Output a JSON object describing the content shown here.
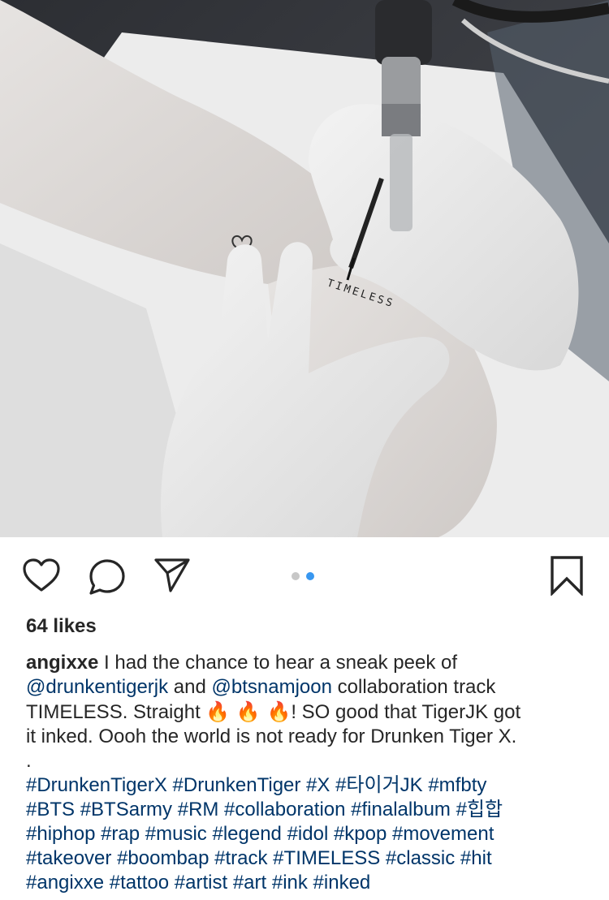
{
  "post": {
    "image": {
      "tattoo_text": "TIMELESS"
    },
    "actions": {
      "like_icon": "heart-outline-icon",
      "comment_icon": "comment-bubble-icon",
      "share_icon": "paper-plane-icon",
      "save_icon": "bookmark-outline-icon"
    },
    "carousel": {
      "count": 2,
      "active_index": 1
    },
    "likes_text": "64 likes",
    "caption": {
      "username": "angixxe",
      "line1_rest": " I had the chance to hear a sneak peek of",
      "mention1": "@drunkentigerjk",
      "and_word": " and ",
      "mention2": "@btsnamjoon",
      "line2_rest": " collaboration track",
      "line3_start": "TIMELESS. Straight ",
      "fire_emoji": "🔥 🔥 🔥",
      "line3_end": "! SO good that TigerJK got",
      "line4": "it inked. Oooh the world is not ready for Drunken Tiger X.",
      "dot_line": ".",
      "hashtag_lines": [
        "#DrunkenTigerX #DrunkenTiger #X #타이거JK #mfbty",
        "#BTS #BTSarmy #RM #collaboration #finalalbum #힙합",
        "#hiphop #rap #music #legend #idol #kpop #movement",
        "#takeover #boombap #track #TIMELESS #classic #hit",
        "#angixxe #tattoo #artist #art #ink #inked"
      ]
    }
  },
  "colors": {
    "text": "#262626",
    "link": "#003569",
    "active_dot": "#3897f0",
    "inactive_dot": "#c7c7c7"
  }
}
